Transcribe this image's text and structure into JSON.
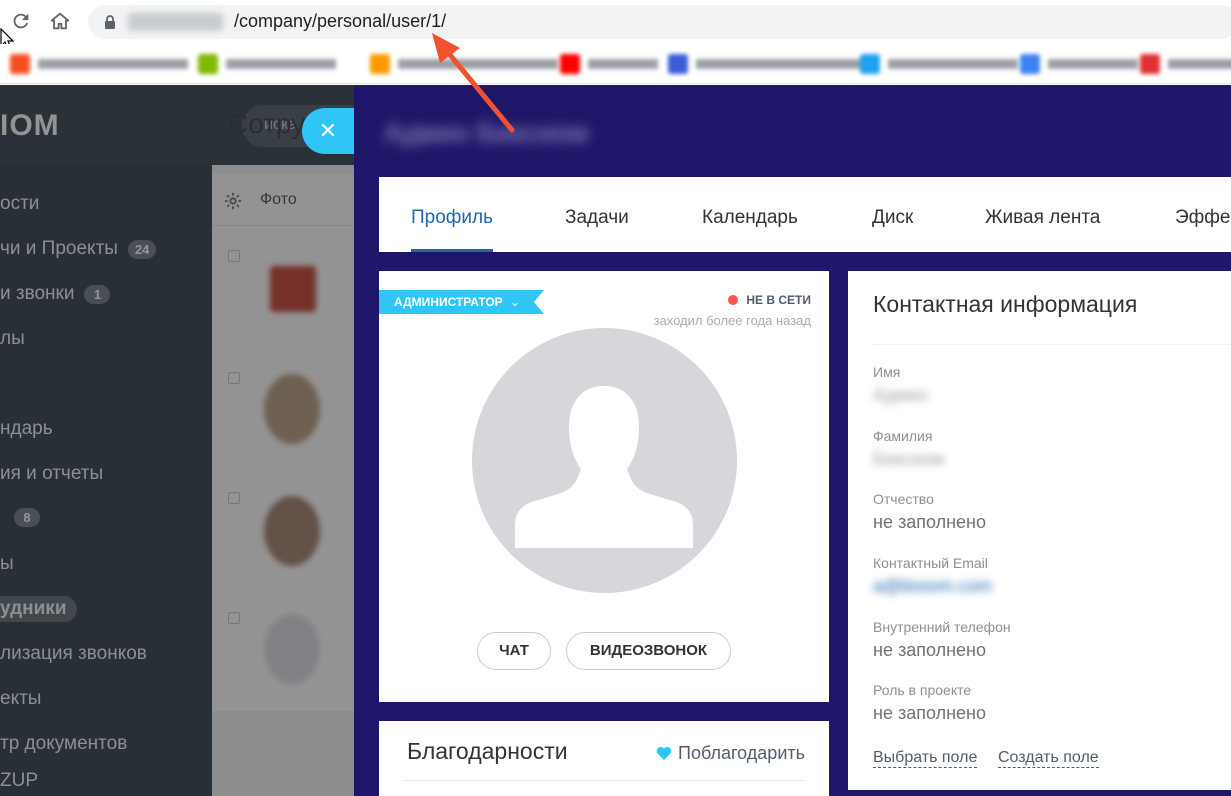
{
  "browser": {
    "url_path": "/company/personal/user/1/",
    "bookmarks": [
      {
        "label": "Главная - Microsoft...",
        "color": "#f25022"
      },
      {
        "label": "Azure Cloud Shell",
        "color": "#7fba00"
      },
      {
        "label": "Amazon Web Servic...",
        "color": "#ff9900"
      },
      {
        "label": "YouTube",
        "color": "#ff0000"
      },
      {
        "label": "Freelance...",
        "color": "#3b5bdb"
      },
      {
        "label": "Live Stream...",
        "color": "#1da1f2"
      },
      {
        "label": "Bitrix24",
        "color": "#3b82f6"
      },
      {
        "label": "Bitrix24...",
        "color": "#e03131"
      }
    ]
  },
  "portal": {
    "logo": "IOM",
    "search_placeholder": "иска",
    "page_title": "Сотрудни",
    "table_photo_header": "Фото",
    "sidebar": [
      {
        "label": "ости",
        "badge": ""
      },
      {
        "label": "чи и Проекты",
        "badge": "24"
      },
      {
        "label": "и звонки",
        "badge": "1"
      },
      {
        "label": "лы",
        "badge": ""
      },
      {
        "label": "",
        "badge": ""
      },
      {
        "label": "ндарь",
        "badge": ""
      },
      {
        "label": "ия и отчеты",
        "badge": ""
      },
      {
        "label": "",
        "badge": "8"
      },
      {
        "label": "ы",
        "badge": ""
      },
      {
        "label": "удники",
        "badge": ""
      },
      {
        "label": "лизация звонков",
        "badge": ""
      },
      {
        "label": "екты",
        "badge": ""
      },
      {
        "label": "тр документов",
        "badge": ""
      },
      {
        "label": "ZUP",
        "badge": ""
      }
    ]
  },
  "profile": {
    "user_name": "Админ Биксиом",
    "tabs": [
      "Профиль",
      "Задачи",
      "Календарь",
      "Диск",
      "Живая лента",
      "Эффе"
    ],
    "role": "АДМИНИСТРАТОР",
    "status": "НЕ В СЕТИ",
    "last_seen": "заходил более года назад",
    "chat_button": "ЧАТ",
    "video_button": "ВИДЕОЗВОНОК",
    "thanks_title": "Благодарности",
    "thanks_button": "Поблагодарить"
  },
  "contact": {
    "title": "Контактная информация",
    "fields": [
      {
        "label": "Имя",
        "value": "Админ"
      },
      {
        "label": "Фамилия",
        "value": "Биксиом"
      },
      {
        "label": "Отчество",
        "value": "не заполнено"
      },
      {
        "label": "Контактный Email",
        "value": "a@bixiom.com"
      },
      {
        "label": "Внутренний телефон",
        "value": "не заполнено"
      },
      {
        "label": "Роль в проекте",
        "value": "не заполнено"
      }
    ],
    "select_field": "Выбрать поле",
    "create_field": "Создать поле"
  },
  "colors": {
    "slider_bg": "#1e1668",
    "accent": "#2067b0",
    "role_tag": "#2fc6f6",
    "offline_dot": "#ff5752",
    "annotation_arrow": "#f0522d"
  }
}
